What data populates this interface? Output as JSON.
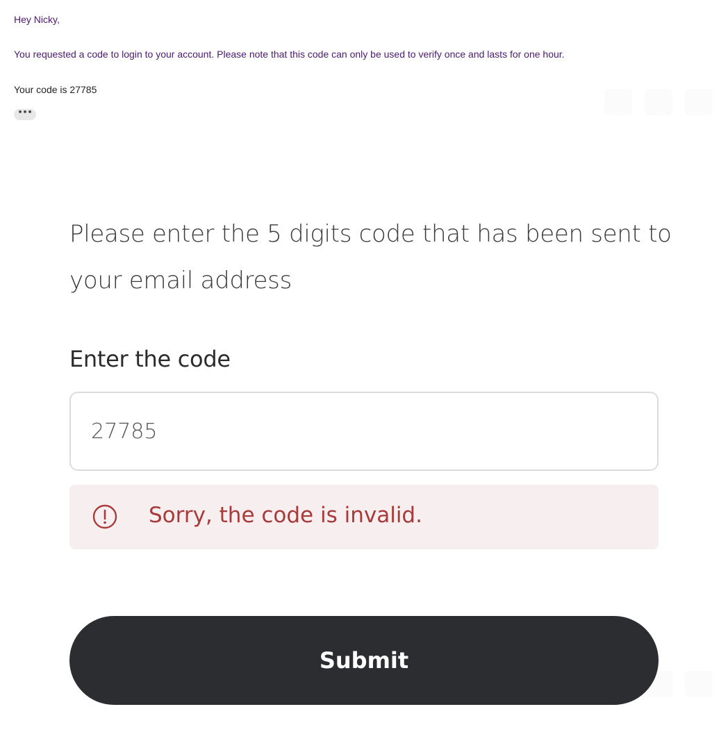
{
  "email": {
    "greeting": "Hey Nicky,",
    "body": "You requested a code to login to your account. Please note that this code can only be used to verify once and lasts for one hour.",
    "code_line": "Your code is 27785",
    "more_label": "•••"
  },
  "verification": {
    "instructions": "Please enter the 5 digits code that has been sent to your email address",
    "code_label": "Enter the code",
    "code_value": "27785",
    "error_message": "Sorry, the code is invalid.",
    "submit_label": "Submit"
  },
  "colors": {
    "email_text": "#4b1a6e",
    "error_text": "#a83a3a",
    "error_background": "#f7eeef",
    "button_background": "#2c2d31"
  },
  "icons": {
    "error": "exclamation-circle-icon"
  }
}
